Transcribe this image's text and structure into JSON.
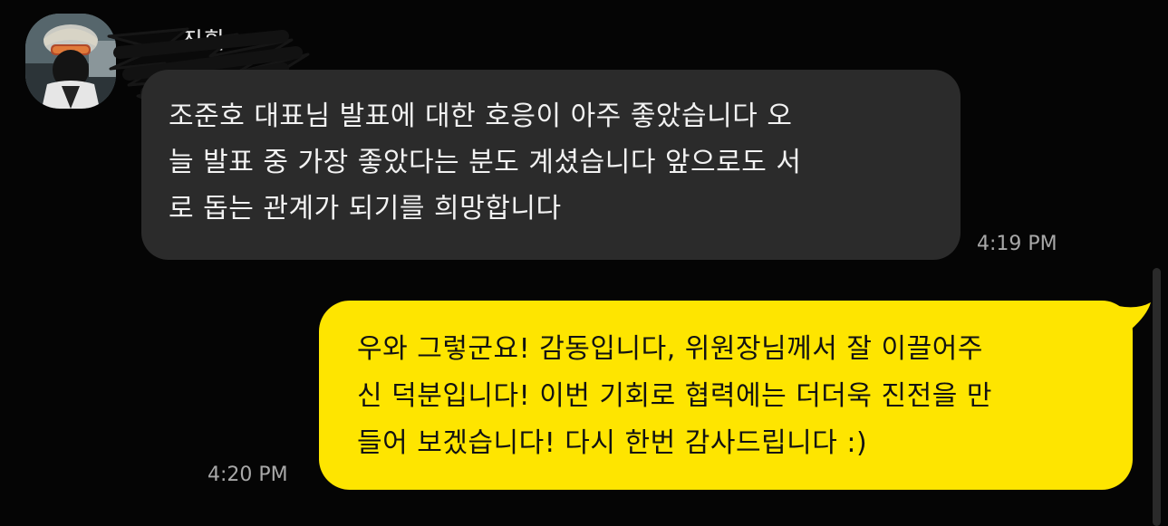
{
  "chat": {
    "sender_name": "진환",
    "incoming": {
      "text": "조준호 대표님 발표에 대한 호응이 아주 좋았습니다 오\n늘 발표 중 가장 좋았다는 분도 계셨습니다 앞으로도 서\n로 돕는 관계가 되기를 희망합니다",
      "time": "4:19 PM"
    },
    "outgoing": {
      "text": "우와 그렇군요! 감동입니다, 위원장님께서 잘 이끌어주\n신 덕분입니다! 이번 기회로 협력에는 더더욱 진전을 만\n들어 보겠습니다! 다시 한번 감사드립니다 :)",
      "time": "4:20 PM"
    }
  },
  "colors": {
    "background": "#050505",
    "incoming_bubble": "#2b2b2b",
    "outgoing_bubble": "#fee500",
    "timestamp": "#a8a8a8"
  },
  "icons": {
    "avatar": "profile-photo-cyclist",
    "redaction": "black-marker-scribble"
  }
}
